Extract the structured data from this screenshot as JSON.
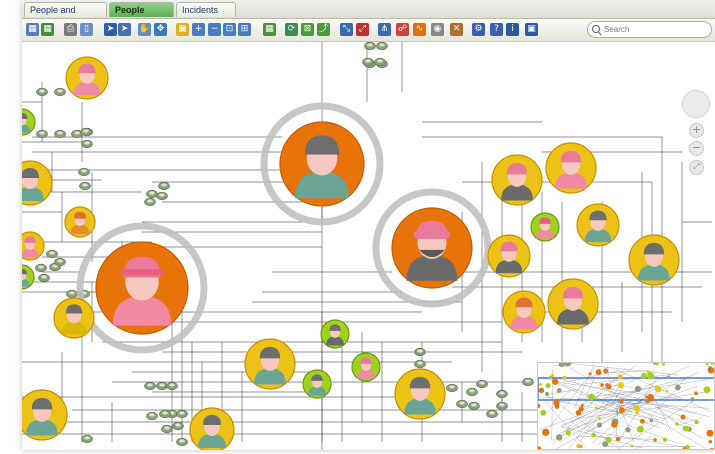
{
  "tabs": [
    {
      "label": "People and Incidents",
      "active": false
    },
    {
      "label": "People Network",
      "active": true
    },
    {
      "label": "Incidents Map",
      "active": false
    }
  ],
  "toolbar": {
    "icons": [
      "layout-icon",
      "layout-alt-icon",
      "print-icon",
      "page-icon",
      "select-arrow-icon",
      "select-alt-icon",
      "pan-hand-icon",
      "move-icon",
      "zoom-area-icon",
      "zoom-in-icon",
      "zoom-out-icon",
      "zoom-fit-icon",
      "zoom-reset-icon",
      "grid-icon",
      "refresh-icon",
      "fit-window-icon",
      "export-icon",
      "expand-icon",
      "collapse-icon",
      "hierarchy-icon",
      "link-icon",
      "path-icon",
      "focus-icon",
      "delete-icon",
      "settings-icon",
      "help-icon",
      "info-icon",
      "window-icon"
    ]
  },
  "search": {
    "placeholder": "Search"
  },
  "nav": {
    "zoom_in": "+",
    "zoom_out": "−",
    "fit": "⤢"
  },
  "minimap": {
    "close": "×"
  },
  "colors": {
    "orange": "#e87308",
    "yellow": "#ecc216",
    "lime": "#9fd21c",
    "halo": "#bdbdbd",
    "edge": "#3a3a3a",
    "accent_tab": "#6bba5f"
  }
}
